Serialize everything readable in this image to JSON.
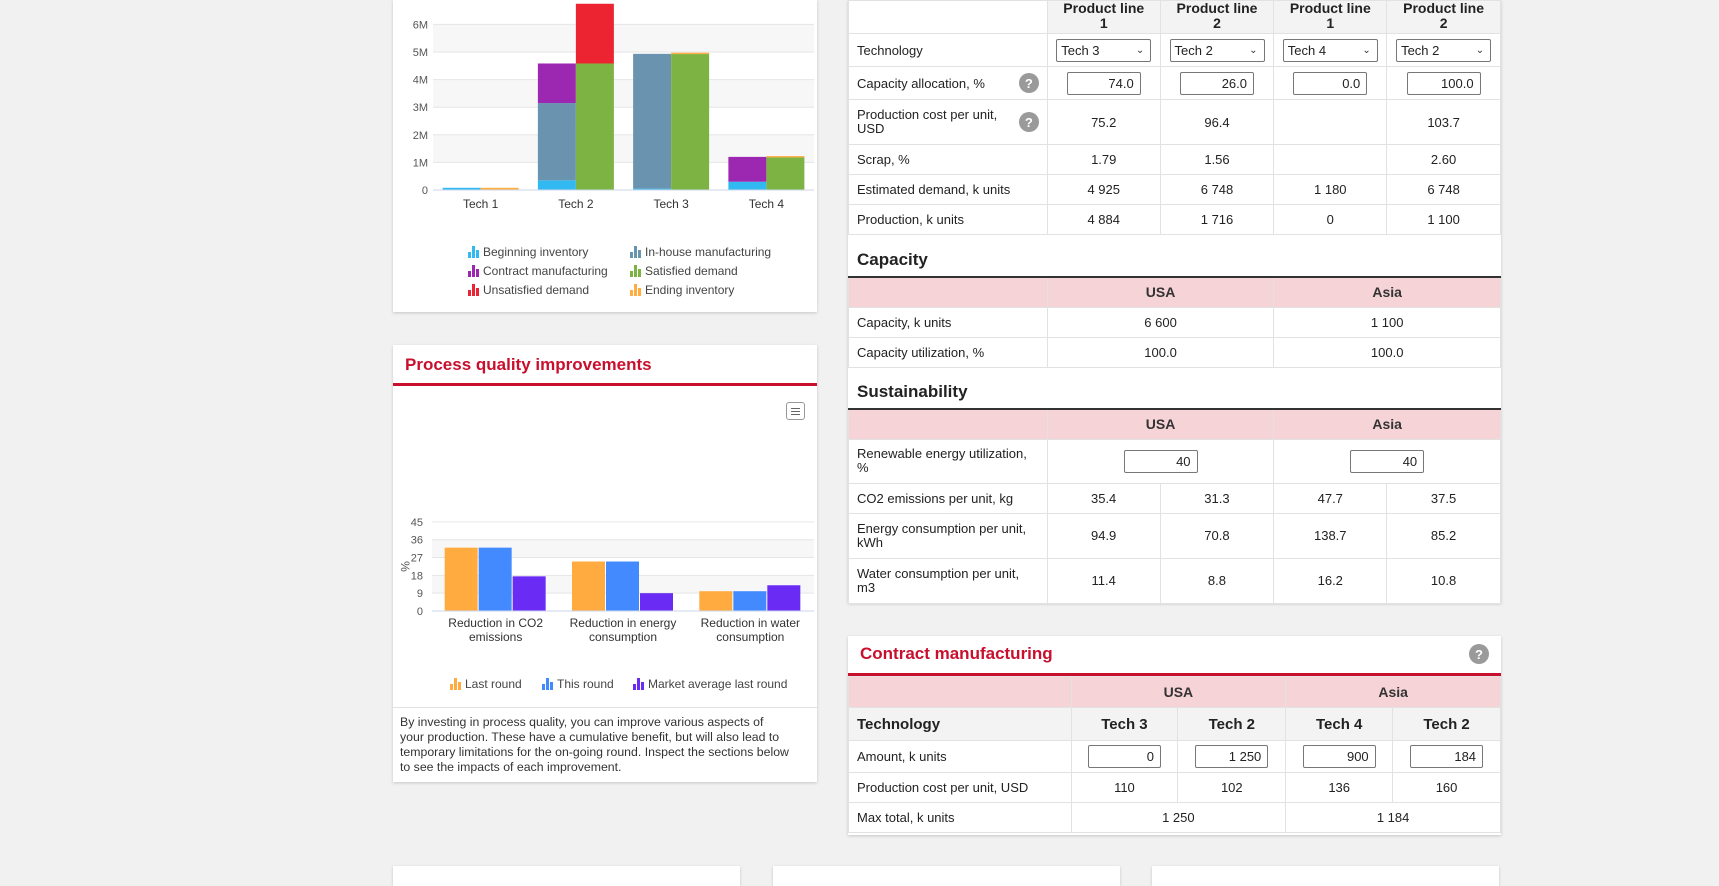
{
  "colors": {
    "accent": "#c8102e",
    "header_pink": "#f6d3d7",
    "beginning_inventory": "#33b9f2",
    "inhouse_manufacturing": "#6a93b0",
    "contract_manufacturing": "#9c27b0",
    "satisfied_demand": "#7cb342",
    "unsatisfied_demand": "#ec2330",
    "ending_inventory": "#ffad42",
    "last_round": "#ffab40",
    "this_round": "#448aff",
    "market_average": "#6a2bf5"
  },
  "chart_data": [
    {
      "type": "bar",
      "stacked": true,
      "categories": [
        "Tech 1",
        "Tech 2",
        "Tech 3",
        "Tech 4"
      ],
      "ytick_labels": [
        "0",
        "1M",
        "2M",
        "3M",
        "4M",
        "5M",
        "6M"
      ],
      "ylim": [
        0,
        7000000
      ],
      "stacks": [
        {
          "name": "left",
          "series": [
            "Beginning inventory",
            "In-house manufacturing",
            "Contract manufacturing"
          ]
        },
        {
          "name": "right",
          "series": [
            "Satisfied demand",
            "Unsatisfied demand",
            "Ending inventory"
          ]
        }
      ],
      "series": [
        {
          "name": "Beginning inventory",
          "values": [
            80000,
            350000,
            50000,
            300000
          ]
        },
        {
          "name": "In-house manufacturing",
          "values": [
            0,
            2800000,
            4884000,
            0
          ]
        },
        {
          "name": "Contract manufacturing",
          "values": [
            0,
            1434000,
            0,
            900000
          ]
        },
        {
          "name": "Satisfied demand",
          "values": [
            0,
            4584000,
            4925000,
            1180000
          ]
        },
        {
          "name": "Unsatisfied demand",
          "values": [
            0,
            2164000,
            0,
            0
          ]
        },
        {
          "name": "Ending inventory",
          "values": [
            80000,
            0,
            50000,
            50000
          ]
        }
      ],
      "legend": [
        "Beginning inventory",
        "In-house manufacturing",
        "Contract manufacturing",
        "Satisfied demand",
        "Unsatisfied demand",
        "Ending inventory"
      ]
    },
    {
      "type": "bar",
      "title": "Process quality improvements",
      "categories": [
        "Reduction in CO2 emissions",
        "Reduction in energy consumption",
        "Reduction in water consumption"
      ],
      "category_lines": [
        [
          "Reduction in CO2",
          "emissions"
        ],
        [
          "Reduction in energy",
          "consumption"
        ],
        [
          "Reduction in water",
          "consumption"
        ]
      ],
      "ylabel": "%",
      "ylim": [
        0,
        45
      ],
      "ytick_labels": [
        "0",
        "9",
        "18",
        "27",
        "36",
        "45"
      ],
      "series": [
        {
          "name": "Last round",
          "values": [
            32,
            25,
            10
          ]
        },
        {
          "name": "This round",
          "values": [
            32,
            25,
            10
          ]
        },
        {
          "name": "Market average last round",
          "values": [
            17.5,
            9,
            13
          ]
        }
      ]
    }
  ],
  "quality_panel": {
    "title": "Process quality improvements",
    "description": "By investing in process quality, you can improve various aspects of your production. These have a cumulative benefit, but will also lead to temporary limitations for the on-going round. Inspect the sections below to see the impacts of each improvement."
  },
  "production": {
    "headers": [
      "Product line\n1",
      "Product line\n2",
      "Product line\n1",
      "Product line\n2"
    ],
    "technology_label": "Technology",
    "technology_values": [
      "Tech 3",
      "Tech 2",
      "Tech 4",
      "Tech 2"
    ],
    "capacity_allocation_label": "Capacity allocation, %",
    "capacity_allocation_values": [
      "74.0",
      "26.0",
      "0.0",
      "100.0"
    ],
    "cost_label": "Production cost per unit, USD",
    "cost_values": [
      "75.2",
      "96.4",
      "",
      "103.7"
    ],
    "scrap_label": "Scrap, %",
    "scrap_values": [
      "1.79",
      "1.56",
      "",
      "2.60"
    ],
    "demand_label": "Estimated demand, k units",
    "demand_values": [
      "4 925",
      "6 748",
      "1 180",
      "6 748"
    ],
    "production_label": "Production, k units",
    "production_values": [
      "4 884",
      "1 716",
      "0",
      "1 100"
    ]
  },
  "capacity": {
    "title": "Capacity",
    "regions": [
      "USA",
      "Asia"
    ],
    "rows": [
      {
        "label": "Capacity, k units",
        "values": [
          "6 600",
          "1 100"
        ]
      },
      {
        "label": "Capacity utilization, %",
        "values": [
          "100.0",
          "100.0"
        ]
      }
    ]
  },
  "sustainability": {
    "title": "Sustainability",
    "regions": [
      "USA",
      "Asia"
    ],
    "renewable_label": "Renewable energy utilization, %",
    "renewable_values": [
      "40",
      "40"
    ],
    "rows": [
      {
        "label": "CO2 emissions per unit, kg",
        "values": [
          "35.4",
          "31.3",
          "47.7",
          "37.5"
        ]
      },
      {
        "label": "Energy consumption per unit, kWh",
        "values": [
          "94.9",
          "70.8",
          "138.7",
          "85.2"
        ]
      },
      {
        "label": "Water consumption per unit, m3",
        "values": [
          "11.4",
          "8.8",
          "16.2",
          "10.8"
        ]
      }
    ]
  },
  "contract": {
    "title": "Contract manufacturing",
    "regions": [
      "USA",
      "Asia"
    ],
    "technology_label": "Technology",
    "techs": [
      "Tech 3",
      "Tech 2",
      "Tech 4",
      "Tech 2"
    ],
    "amount_label": "Amount, k units",
    "amounts": [
      "0",
      "1 250",
      "900",
      "184"
    ],
    "cost_label": "Production cost per unit, USD",
    "costs": [
      "110",
      "102",
      "136",
      "160"
    ],
    "max_label": "Max total, k units",
    "max_values": [
      "1 250",
      "1 184"
    ]
  },
  "help_glyph": "?"
}
